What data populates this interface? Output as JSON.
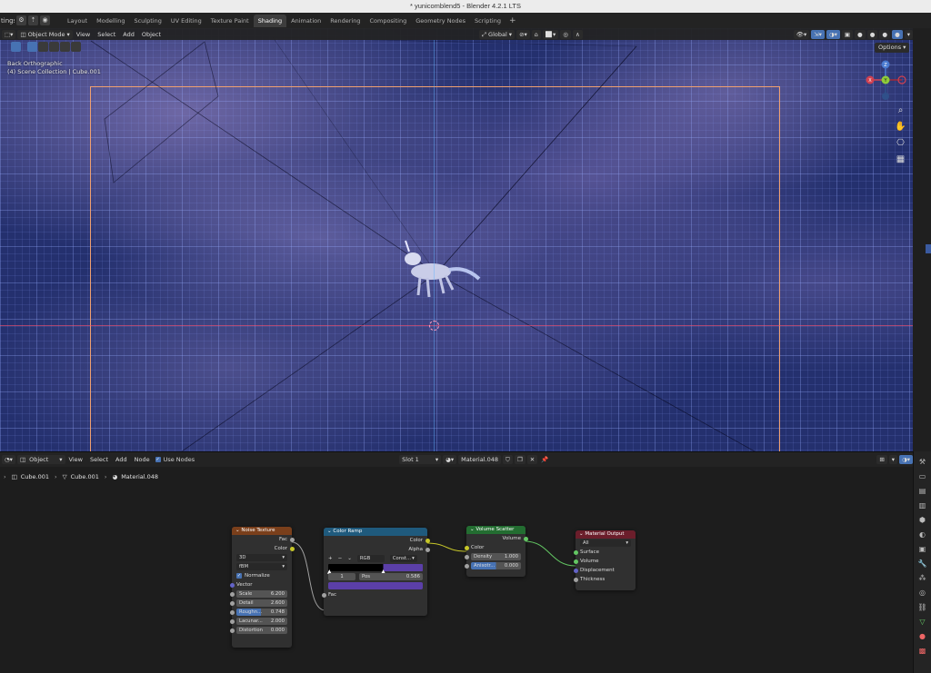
{
  "window": {
    "title": "* yunicomblend5 - Blender 4.2.1 LTS"
  },
  "topbar": {
    "left_cut": "tings",
    "workspaces": [
      "Layout",
      "Modelling",
      "Sculpting",
      "UV Editing",
      "Texture Paint",
      "Shading",
      "Animation",
      "Rendering",
      "Compositing",
      "Geometry Nodes",
      "Scripting"
    ],
    "active_workspace": "Shading",
    "plus": "+"
  },
  "viewport": {
    "mode": "Object Mode",
    "menus": [
      "View",
      "Select",
      "Add",
      "Object"
    ],
    "transform_orientation": "Global",
    "options_label": "Options",
    "view_name": "Back Orthographic",
    "collection_info": "(4) Scene Collection | Cube.001",
    "gizmo_labels": {
      "z": "Z",
      "x": "X",
      "y": "Y"
    }
  },
  "node_editor": {
    "editor_type": "Object",
    "menus": [
      "View",
      "Select",
      "Add",
      "Node"
    ],
    "use_nodes_label": "Use Nodes",
    "slot": "Slot 1",
    "material": "Material.048",
    "breadcrumb": [
      "Cube.001",
      "Cube.001",
      "Material.048"
    ],
    "nodes": {
      "noise": {
        "title": "Noise Texture",
        "outputs": [
          "Fac",
          "Color"
        ],
        "dimension": "3D",
        "type": "fBM",
        "normalize_label": "Normalize",
        "vector_label": "Vector",
        "fields": [
          {
            "label": "Scale",
            "value": "6.200"
          },
          {
            "label": "Detail",
            "value": "2.600"
          },
          {
            "label": "Roughn...",
            "value": "0.748"
          },
          {
            "label": "Lacunar...",
            "value": "2.000"
          },
          {
            "label": "Distortion",
            "value": "0.000"
          }
        ]
      },
      "ramp": {
        "title": "Color Ramp",
        "outputs": [
          "Color",
          "Alpha"
        ],
        "controls": [
          "+",
          "−",
          "⌄"
        ],
        "color_mode": "RGB",
        "interpolation": "Const...",
        "index": "1",
        "pos_label": "Pos",
        "pos_value": "0.586",
        "input": "Fac"
      },
      "scatter": {
        "title": "Volume Scatter",
        "output": "Volume",
        "color_label": "Color",
        "density_label": "Density",
        "density_value": "1.000",
        "aniso_label": "Anisotr...",
        "aniso_value": "0.000"
      },
      "output": {
        "title": "Material Output",
        "target": "All",
        "inputs": [
          "Surface",
          "Volume",
          "Displacement",
          "Thickness"
        ]
      }
    }
  },
  "colors": {
    "noise_header": "#7a3f1b",
    "ramp_header": "#1f5a7d",
    "scatter_header": "#236d31",
    "output_header": "#6b1e2b",
    "frame": "#f0a070"
  }
}
